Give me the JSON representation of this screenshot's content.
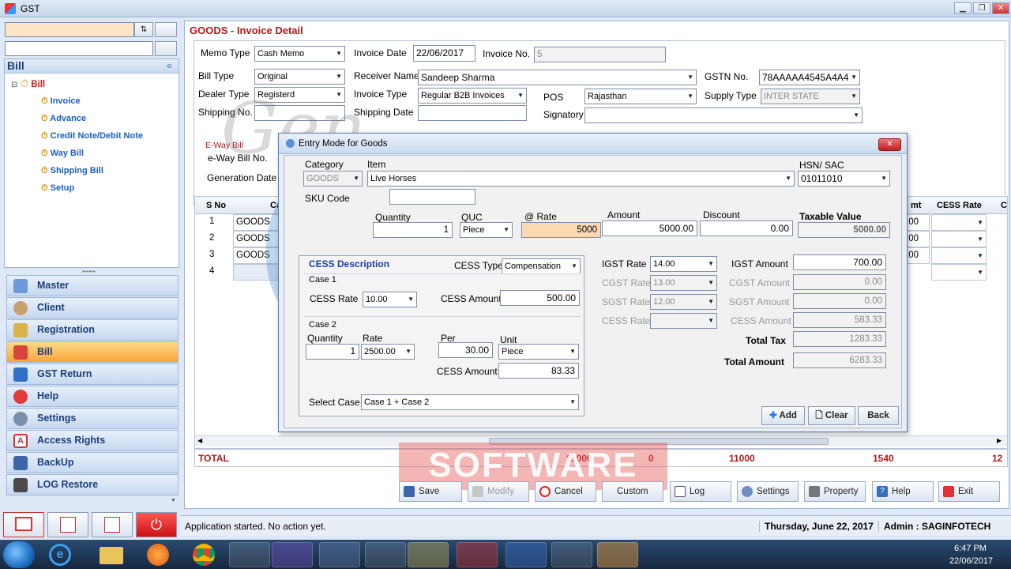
{
  "app": {
    "title": "GST"
  },
  "sidebar": {
    "section_title": "Bill",
    "collapse_glyph": "«",
    "tree_root": "Bill",
    "tree_items": [
      "Invoice",
      "Advance",
      "Credit Note/Debit Note",
      "Way Bill",
      "Shipping Bill",
      "Setup"
    ],
    "nav": [
      "Master",
      "Client",
      "Registration",
      "Bill",
      "GST Return",
      "Help",
      "Settings",
      "Access Rights",
      "BackUp",
      "LOG Restore"
    ],
    "active": "Bill"
  },
  "invoice": {
    "header": "GOODS - Invoice Detail",
    "memo_type_label": "Memo Type",
    "memo_type": "Cash Memo",
    "invoice_date_label": "Invoice Date",
    "invoice_date": "22/06/2017",
    "invoice_no_label": "Invoice No.",
    "invoice_no": "5",
    "bill_type_label": "Bill Type",
    "bill_type": "Original",
    "receiver_label": "Receiver Name",
    "receiver": "Sandeep Sharma",
    "gstn_label": "GSTN No.",
    "gstn": "78AAAAA4545A4A4",
    "dealer_type_label": "Dealer Type",
    "dealer_type": "Registerd",
    "invoice_type_label": "Invoice Type",
    "invoice_type": "Regular B2B Invoices",
    "pos_label": "POS",
    "pos": "Rajasthan",
    "supply_type_label": "Supply Type",
    "supply_type": "INTER STATE",
    "shipping_no_label": "Shipping No.",
    "shipping_date_label": "Shipping Date",
    "signatory_label": "Signatory",
    "eway_bill_label": "E-Way Bill",
    "eway_bill_no_label": "e-Way Bill No.",
    "generation_date_label": "Generation Date"
  },
  "grid": {
    "headers": [
      "S No",
      "Ca",
      "mt",
      "CESS Rate",
      "C"
    ],
    "rows": [
      {
        "sno": "1",
        "cat": "GOODS",
        "amt": ".00"
      },
      {
        "sno": "2",
        "cat": "GOODS",
        "amt": ".00"
      },
      {
        "sno": "3",
        "cat": "GOODS",
        "amt": ".00"
      },
      {
        "sno": "4",
        "cat": "",
        "amt": ""
      }
    ],
    "total_label": "TOTAL",
    "totals": [
      "11000",
      "0",
      "11000",
      "1540",
      "12"
    ]
  },
  "dialog": {
    "title": "Entry Mode for Goods",
    "category_label": "Category",
    "category": "GOODS",
    "item_label": "Item",
    "item": "Live Horses",
    "hsn_label": "HSN/ SAC",
    "hsn": "01011010",
    "sku_label": "SKU Code",
    "sku": "",
    "quantity_label": "Quantity",
    "quantity": "1",
    "quc_label": "QUC",
    "quc": "Piece",
    "rate_label": "@ Rate",
    "rate": "5000",
    "amount_label": "Amount",
    "amount": "5000.00",
    "discount_label": "Discount",
    "discount": "0.00",
    "taxable_label": "Taxable Value",
    "taxable": "5000.00",
    "cess_desc_label": "CESS Description",
    "cess_type_label": "CESS Type",
    "cess_type": "Compensation",
    "case1_label": "Case 1",
    "cess_rate_label": "CESS Rate",
    "cess_rate": "10.00",
    "cess_amount_label": "CESS Amount",
    "cess_amount1": "500.00",
    "case2_label": "Case 2",
    "c2_quantity_label": "Quantity",
    "c2_quantity": "1",
    "c2_rate_label": "Rate",
    "c2_rate": "2500.00",
    "c2_per_label": "Per",
    "c2_per": "30.00",
    "c2_unit_label": "Unit",
    "c2_unit": "Piece",
    "c2_cess_amount_label": "CESS Amount",
    "c2_cess_amount": "83.33",
    "select_case_label": "Select Case",
    "select_case": "Case 1 + Case 2",
    "igst_rate_label": "IGST Rate",
    "igst_rate": "14.00",
    "cgst_rate_label": "CGST Rate",
    "cgst_rate": "13.00",
    "sgst_rate_label": "SGST Rate",
    "sgst_rate": "12.00",
    "cess_rate2_label": "CESS Rate",
    "igst_amount_label": "IGST Amount",
    "igst_amount": "700.00",
    "cgst_amount_label": "CGST Amount",
    "cgst_amount": "0.00",
    "sgst_amount_label": "SGST Amount",
    "sgst_amount": "0.00",
    "cess_amount2_label": "CESS Amount",
    "cess_amount2": "583.33",
    "total_tax_label": "Total Tax",
    "total_tax": "1283.33",
    "total_amount_label": "Total Amount",
    "total_amount": "6283.33",
    "add": "Add",
    "clear": "Clear",
    "back": "Back"
  },
  "bottom_buttons": [
    "Save",
    "Modify",
    "Cancel",
    "Custom",
    "Log",
    "Settings",
    "Property",
    "Help",
    "Exit"
  ],
  "status": {
    "message": "Application started. No action yet.",
    "date": "Thursday, June 22, 2017",
    "admin": "Admin : SAGINFOTECH"
  },
  "watermark": {
    "main": "GST",
    "sub": "SOFTWARE",
    "script": "Gen"
  },
  "taskbar": {
    "time": "6:47 PM",
    "date": "22/06/2017"
  }
}
